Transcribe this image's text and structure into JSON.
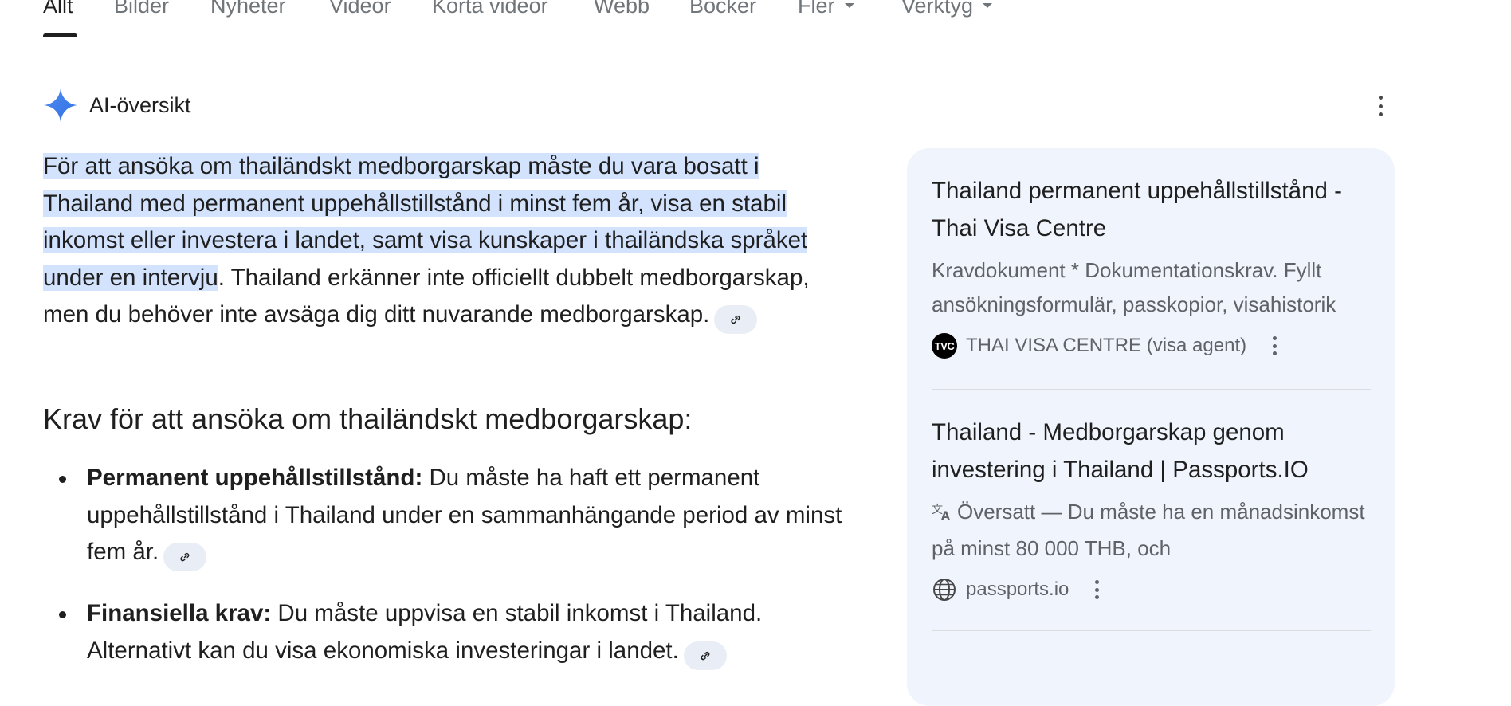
{
  "tabs": [
    {
      "label": "Allt",
      "active": true
    },
    {
      "label": "Bilder"
    },
    {
      "label": "Nyheter"
    },
    {
      "label": "Videor"
    },
    {
      "label": "Korta videor"
    },
    {
      "label": "Webb"
    },
    {
      "label": "Böcker"
    },
    {
      "label": "Fler",
      "has_dropdown": true
    },
    {
      "label": "Verktyg",
      "has_dropdown": true
    }
  ],
  "ai_overview": {
    "title": "AI-översikt",
    "icon": "sparkle-icon",
    "accent_color": "#4285f4",
    "highlight_color": "#d3e3fd",
    "highlighted_text": "För att ansöka om thailändskt medborgarskap måste du vara bosatt i Thailand med permanent uppehållstillstånd i minst fem år, visa en stabil inkomst eller investera i landet, samt visa kunskaper i thailändska språket under en intervju",
    "rest_text": ". Thailand erkänner inte officiellt dubbelt medborgarskap, men du behöver inte avsäga dig ditt nuvarande medborgarskap.",
    "section_heading": "Krav för att ansöka om thailändskt medborgarskap:",
    "requirements": [
      {
        "label": "Permanent uppehållstillstånd:",
        "text": " Du måste ha haft ett permanent uppehållstillstånd i Thailand under en sammanhängande period av minst fem år."
      },
      {
        "label": "Finansiella krav:",
        "text": " Du måste uppvisa en stabil inkomst i Thailand. Alternativt kan du visa ekonomiska investeringar i landet."
      }
    ]
  },
  "sources": [
    {
      "title": "Thailand permanent uppehållstillstånd - Thai Visa Centre",
      "snippet": "Kravdokument * Dokumentationskrav. Fyllt ansökningsformulär, passkopior, visahistorik",
      "site": "THAI VISA CENTRE (visa agent)",
      "favicon_text": "TVC"
    },
    {
      "title": "Thailand - Medborgarskap genom investering i Thailand | Passports.IO",
      "translated_label": "Översatt",
      "snippet": " — Du måste ha en månadsinkomst på minst 80 000 THB, och",
      "site": "passports.io",
      "favicon": "globe-icon"
    }
  ]
}
